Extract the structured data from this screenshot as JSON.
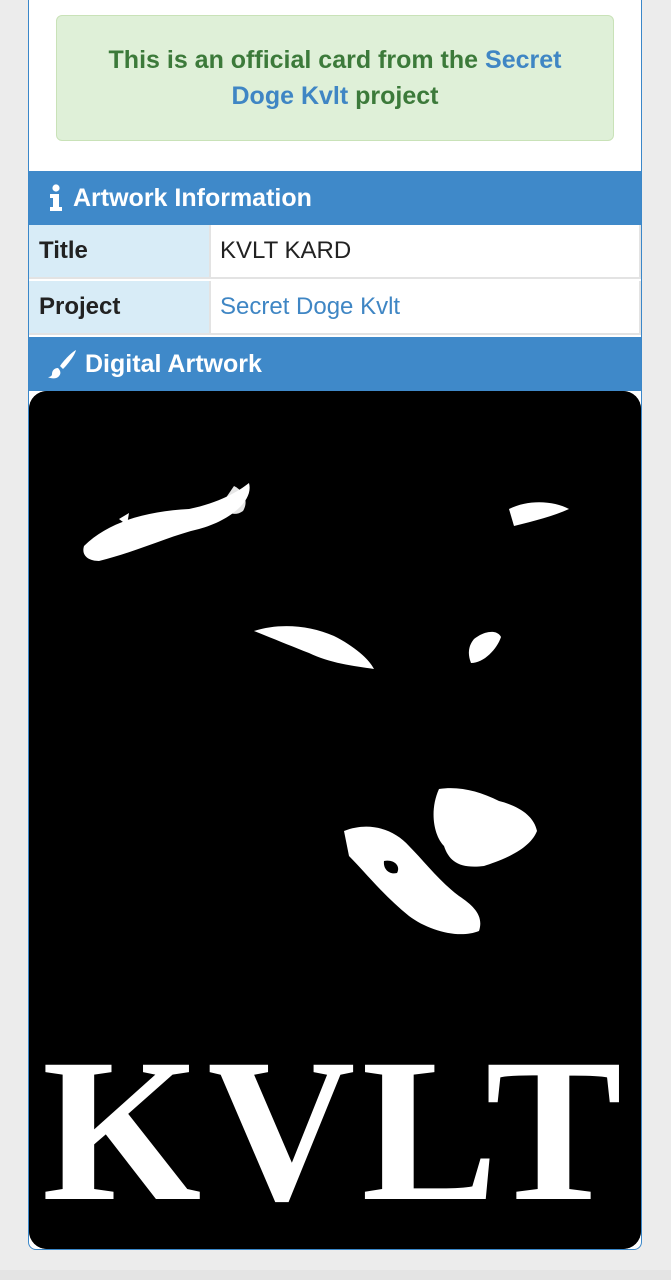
{
  "notice": {
    "prefix": "This is an official card from the",
    "link_text": "Secret Doge Kvlt",
    "suffix": "project"
  },
  "artwork_info": {
    "header": "Artwork Information",
    "icon": "info-icon",
    "rows": [
      {
        "label": "Title",
        "value": "KVLT KARD"
      },
      {
        "label": "Project",
        "value": "Secret Doge Kvlt"
      }
    ]
  },
  "digital_artwork": {
    "header": "Digital Artwork",
    "icon": "paintbrush-icon",
    "image_text": "KVLT"
  },
  "colors": {
    "accent": "#3f89c9",
    "notice_bg": "#dff0d8",
    "notice_text": "#3c7a3a",
    "link": "#3f86c4",
    "label_bg": "#d8ecf7"
  }
}
